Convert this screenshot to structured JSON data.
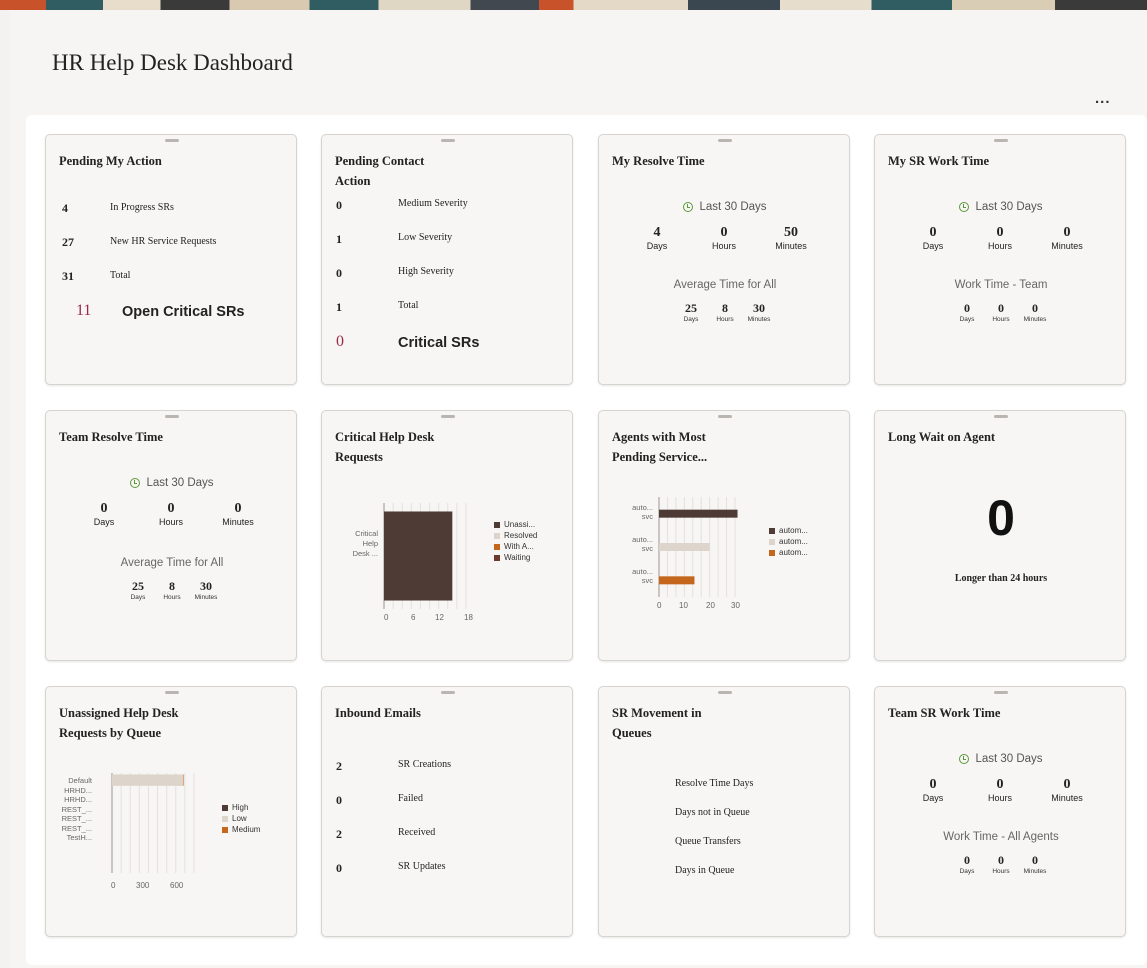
{
  "page": {
    "title": "HR Help Desk Dashboard",
    "more_label": "..."
  },
  "colors": {
    "dark": "#4e3b36",
    "light": "#ddd4cb",
    "orange": "#c4661c",
    "maroon": "#6e3a2c",
    "critical": "#9a2a4a",
    "clock": "#5a9a3a"
  },
  "pending_my_action": {
    "title": "Pending My Action",
    "rows": [
      {
        "value": "4",
        "label": "In Progress SRs"
      },
      {
        "value": "27",
        "label": "New HR Service Requests"
      },
      {
        "value": "31",
        "label": "Total"
      }
    ],
    "critical": {
      "value": "11",
      "label": "Open Critical SRs"
    }
  },
  "pending_contact_action": {
    "title": "Pending Contact Action",
    "rows": [
      {
        "value": "0",
        "label": "Medium Severity"
      },
      {
        "value": "1",
        "label": "Low Severity"
      },
      {
        "value": "0",
        "label": "High Severity"
      },
      {
        "value": "1",
        "label": "Total"
      }
    ],
    "critical": {
      "value": "0",
      "label": "Critical SRs"
    }
  },
  "my_resolve_time": {
    "title": "My Resolve Time",
    "period": "Last 30 Days",
    "main": [
      {
        "value": "4",
        "unit": "Days"
      },
      {
        "value": "0",
        "unit": "Hours"
      },
      {
        "value": "50",
        "unit": "Minutes"
      }
    ],
    "sub_title": "Average Time for All",
    "sub": [
      {
        "value": "25",
        "unit": "Days"
      },
      {
        "value": "8",
        "unit": "Hours"
      },
      {
        "value": "30",
        "unit": "Minutes"
      }
    ]
  },
  "my_sr_work_time": {
    "title": "My SR Work Time",
    "period": "Last 30 Days",
    "main": [
      {
        "value": "0",
        "unit": "Days"
      },
      {
        "value": "0",
        "unit": "Hours"
      },
      {
        "value": "0",
        "unit": "Minutes"
      }
    ],
    "sub_title": "Work Time - Team",
    "sub": [
      {
        "value": "0",
        "unit": "Days"
      },
      {
        "value": "0",
        "unit": "Hours"
      },
      {
        "value": "0",
        "unit": "Minutes"
      }
    ]
  },
  "team_resolve_time": {
    "title": "Team Resolve Time",
    "period": "Last 30 Days",
    "main": [
      {
        "value": "0",
        "unit": "Days"
      },
      {
        "value": "0",
        "unit": "Hours"
      },
      {
        "value": "0",
        "unit": "Minutes"
      }
    ],
    "sub_title": "Average Time for All",
    "sub": [
      {
        "value": "25",
        "unit": "Days"
      },
      {
        "value": "8",
        "unit": "Hours"
      },
      {
        "value": "30",
        "unit": "Minutes"
      }
    ]
  },
  "critical_requests": {
    "title": "Critical Help Desk Requests",
    "category_lines": [
      "Critical",
      "Help",
      "Desk ..."
    ],
    "legend": [
      "Unassi...",
      "Resolved",
      "With A...",
      "Waiting"
    ],
    "ticks": [
      "0",
      "6",
      "12",
      "18"
    ]
  },
  "agents_pending": {
    "title": "Agents with Most Pending Service...",
    "categories": [
      {
        "l1": "auto...",
        "l2": "svc"
      },
      {
        "l1": "auto...",
        "l2": "svc"
      },
      {
        "l1": "auto...",
        "l2": "svc"
      }
    ],
    "legend": [
      "autom...",
      "autom...",
      "autom..."
    ],
    "ticks": [
      "0",
      "10",
      "20",
      "30"
    ]
  },
  "long_wait": {
    "title": "Long Wait on Agent",
    "value": "0",
    "label": "Longer than 24 hours"
  },
  "unassigned_by_queue": {
    "title": "Unassigned Help Desk Requests by Queue",
    "categories": [
      "Default",
      "HRHD...",
      "HRHD...",
      "REST_...",
      "REST_...",
      "REST_...",
      "TestH..."
    ],
    "legend": [
      "High",
      "Low",
      "Medium"
    ],
    "ticks": [
      "0",
      "300",
      "600"
    ]
  },
  "inbound_emails": {
    "title": "Inbound Emails",
    "rows": [
      {
        "value": "2",
        "label": "SR Creations"
      },
      {
        "value": "0",
        "label": "Failed"
      },
      {
        "value": "2",
        "label": "Received"
      },
      {
        "value": "0",
        "label": "SR Updates"
      }
    ]
  },
  "sr_movement": {
    "title": "SR Movement in Queues",
    "rows": [
      "Resolve Time Days",
      "Days not in Queue",
      "Queue Transfers",
      "Days in Queue"
    ]
  },
  "team_sr_work_time": {
    "title": "Team SR Work Time",
    "period": "Last 30 Days",
    "main": [
      {
        "value": "0",
        "unit": "Days"
      },
      {
        "value": "0",
        "unit": "Hours"
      },
      {
        "value": "0",
        "unit": "Minutes"
      }
    ],
    "sub_title": "Work Time - All Agents",
    "sub": [
      {
        "value": "0",
        "unit": "Days"
      },
      {
        "value": "0",
        "unit": "Hours"
      },
      {
        "value": "0",
        "unit": "Minutes"
      }
    ]
  },
  "chart_data": [
    {
      "type": "bar",
      "orientation": "horizontal",
      "stacked": true,
      "categories": [
        "Critical Help Desk ..."
      ],
      "series": [
        {
          "name": "Unassi...",
          "values": [
            15
          ]
        },
        {
          "name": "Resolved",
          "values": [
            0
          ]
        },
        {
          "name": "With A...",
          "values": [
            0
          ]
        },
        {
          "name": "Waiting",
          "values": [
            0
          ]
        }
      ],
      "xlim": [
        0,
        18
      ],
      "xticks": [
        0,
        6,
        12,
        18
      ],
      "grid": true,
      "legend": "right"
    },
    {
      "type": "bar",
      "orientation": "horizontal",
      "categories": [
        "auto... svc",
        "auto... svc",
        "auto... svc"
      ],
      "series": [
        {
          "name": "autom...",
          "values": [
            31,
            0,
            0
          ]
        },
        {
          "name": "autom...",
          "values": [
            0,
            20,
            0
          ]
        },
        {
          "name": "autom...",
          "values": [
            0,
            0,
            14
          ]
        }
      ],
      "xlim": [
        0,
        30
      ],
      "xticks": [
        0,
        10,
        20,
        30
      ],
      "grid": true,
      "legend": "right"
    },
    {
      "type": "bar",
      "orientation": "horizontal",
      "stacked": true,
      "categories": [
        "Default",
        "HRHD...",
        "HRHD...",
        "REST_...",
        "REST_...",
        "REST_...",
        "TestH..."
      ],
      "series": [
        {
          "name": "High",
          "values": [
            0,
            0,
            0,
            0,
            0,
            0,
            0
          ]
        },
        {
          "name": "Low",
          "values": [
            650,
            0,
            0,
            0,
            0,
            0,
            0
          ]
        },
        {
          "name": "Medium",
          "values": [
            5,
            0,
            0,
            0,
            0,
            0,
            0
          ]
        }
      ],
      "xlim": [
        0,
        750
      ],
      "xticks": [
        0,
        300,
        600
      ],
      "grid": true,
      "legend": "right"
    }
  ]
}
